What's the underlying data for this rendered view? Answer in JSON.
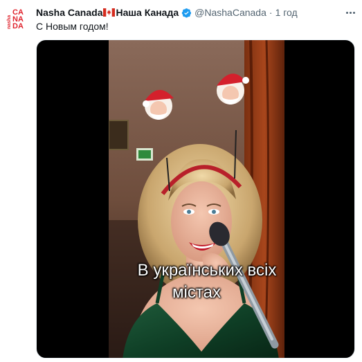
{
  "tweet": {
    "author_name": "Nasha Canada",
    "author_name_local": "Наша Канада",
    "handle": "@NashaCanada",
    "separator": "·",
    "time": "1 год",
    "text": "С Новым годом!",
    "verified_icon": "verified-badge-icon",
    "flag_icon": "canada-flag-icon"
  },
  "avatar": {
    "logo_text_top": "nasha",
    "logo_text_main_1": "CA",
    "logo_text_main_2": "NA",
    "logo_text_main_3": "DA",
    "color": "#e0242e"
  },
  "media": {
    "subtitle_line1": "В українських всіх",
    "subtitle_line2": "містах"
  },
  "colors": {
    "accent_blue": "#1d9bf0",
    "secondary_text": "#536471",
    "brand_red": "#e0242e"
  }
}
